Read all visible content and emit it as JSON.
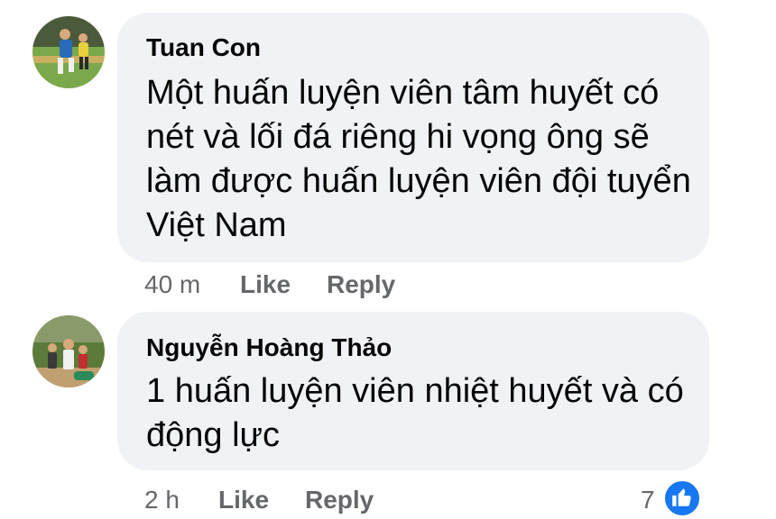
{
  "comments": [
    {
      "author": "Tuan Con",
      "text_lines": [
        "Một huấn luyện viên tâm huyết có",
        "nét và lối đá riêng hi vọng ông sẽ",
        "làm được huấn luyện viên đội tuyển",
        "Việt Nam"
      ],
      "time": "40 m",
      "like_label": "Like",
      "reply_label": "Reply",
      "avatar_icon": "soccer-player-photo"
    },
    {
      "author": "Nguyễn Hoàng Thảo",
      "text_lines": [
        "1 huấn luyện viên nhiệt huyết và có",
        "động lực"
      ],
      "time": "2 h",
      "like_label": "Like",
      "reply_label": "Reply",
      "reaction_count": "7",
      "reaction_icon": "thumbs-up-icon",
      "avatar_icon": "group-photo"
    }
  ],
  "colors": {
    "bubble": "#f0f2f5",
    "meta_text": "#65676b",
    "like_blue": "#1877f2"
  }
}
